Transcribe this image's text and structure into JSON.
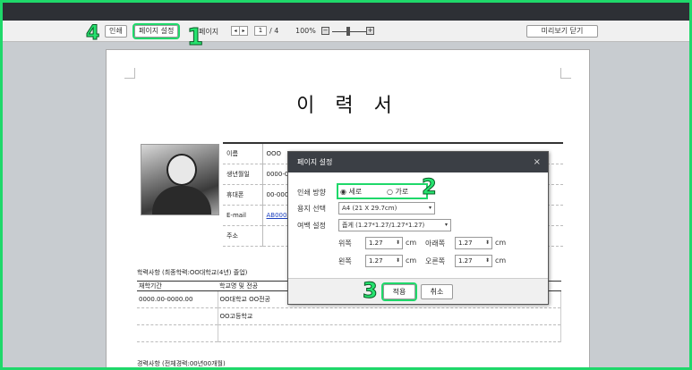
{
  "toolbar": {
    "print_label": "인쇄",
    "page_setup_label": "페이지 설정",
    "page_label": "페이지",
    "current_page": "1",
    "total_pages": "/ 4",
    "zoom": "100%",
    "close_label": "미리보기 닫기"
  },
  "markers": {
    "m1": "1",
    "m2": "2",
    "m3": "3",
    "m4": "4"
  },
  "document": {
    "title": "이 력 서",
    "fields": [
      {
        "label": "이름",
        "value": "OOO"
      },
      {
        "label": "생년월일",
        "value": "0000-0"
      },
      {
        "label": "휴대폰",
        "value": "00-000"
      },
      {
        "label": "E-mail",
        "value": "AB0000"
      },
      {
        "label": "주소",
        "value": ""
      }
    ],
    "education_title": "학력사항 (최종학력:OO대학교(4년) 졸업)",
    "education_headers": [
      "재학기간",
      "학교명 및 전공"
    ],
    "education_rows": [
      {
        "period": "0000.00-0000.00",
        "school": "OO대학교 OO전공"
      },
      {
        "period": "",
        "school": "OO고등학교"
      },
      {
        "period": "",
        "school": ""
      }
    ],
    "career_title": "경력사항 (전체경력:00년00개월)"
  },
  "dialog": {
    "title": "페이지 설정",
    "close": "×",
    "orientation_label": "인쇄 방향",
    "portrait": "세로",
    "landscape": "가로",
    "paper_label": "용지 선택",
    "paper_value": "A4 (21 X 29.7cm)",
    "margin_label": "여백 설정",
    "margin_value": "좁게 (1.27*1.27/1.27*1.27)",
    "top_label": "위쪽",
    "top_value": "1.27",
    "bottom_label": "아래쪽",
    "bottom_value": "1.27",
    "left_label": "왼쪽",
    "left_value": "1.27",
    "right_label": "오른쪽",
    "right_value": "1.27",
    "unit": "cm",
    "apply": "적용",
    "cancel": "취소"
  },
  "colors": {
    "highlight": "#1fd86a",
    "dialog_header": "#3b3f45",
    "topbar": "#2d3035"
  }
}
